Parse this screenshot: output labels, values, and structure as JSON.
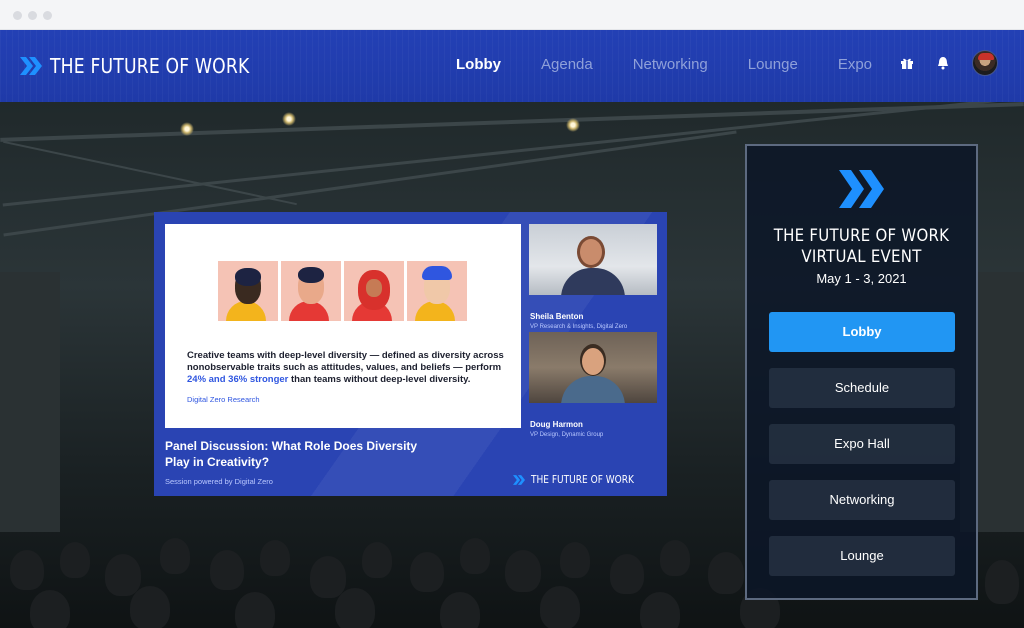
{
  "header": {
    "brand": "THE FUTURE OF WORK",
    "nav": [
      {
        "label": "Lobby",
        "active": true
      },
      {
        "label": "Agenda",
        "active": false
      },
      {
        "label": "Networking",
        "active": false
      },
      {
        "label": "Lounge",
        "active": false
      },
      {
        "label": "Expo",
        "active": false
      }
    ],
    "icons": [
      "gift-icon",
      "bell-icon",
      "avatar"
    ]
  },
  "slide": {
    "text_before": "Creative teams with deep-level diversity — defined as diversity across nonobservable traits such as attitudes, values, and beliefs — perform ",
    "text_highlight": "24% and 36% stronger",
    "text_after": " than teams without deep-level diversity.",
    "source": "Digital Zero Research"
  },
  "speakers": [
    {
      "name": "Sheila Benton",
      "role": "VP Research & Insights, Digital Zero"
    },
    {
      "name": "Doug Harmon",
      "role": "VP Design, Dynamic Group"
    }
  ],
  "session": {
    "title": "Panel Discussion: What Role Does Diversity Play in Creativity?",
    "powered_by": "Session powered by Digital Zero",
    "brand": "THE FUTURE OF WORK"
  },
  "panel": {
    "title_line1": "THE FUTURE OF WORK",
    "title_line2": "VIRTUAL EVENT",
    "date": "May 1 - 3, 2021",
    "menu": [
      {
        "label": "Lobby",
        "active": true
      },
      {
        "label": "Schedule",
        "active": false
      },
      {
        "label": "Expo Hall",
        "active": false
      },
      {
        "label": "Networking",
        "active": false
      },
      {
        "label": "Lounge",
        "active": false
      }
    ]
  },
  "colors": {
    "navbar": "#2340b5",
    "accent": "#2196f3",
    "chevron": "#1e90ff",
    "slide_highlight": "#2f56e0"
  }
}
